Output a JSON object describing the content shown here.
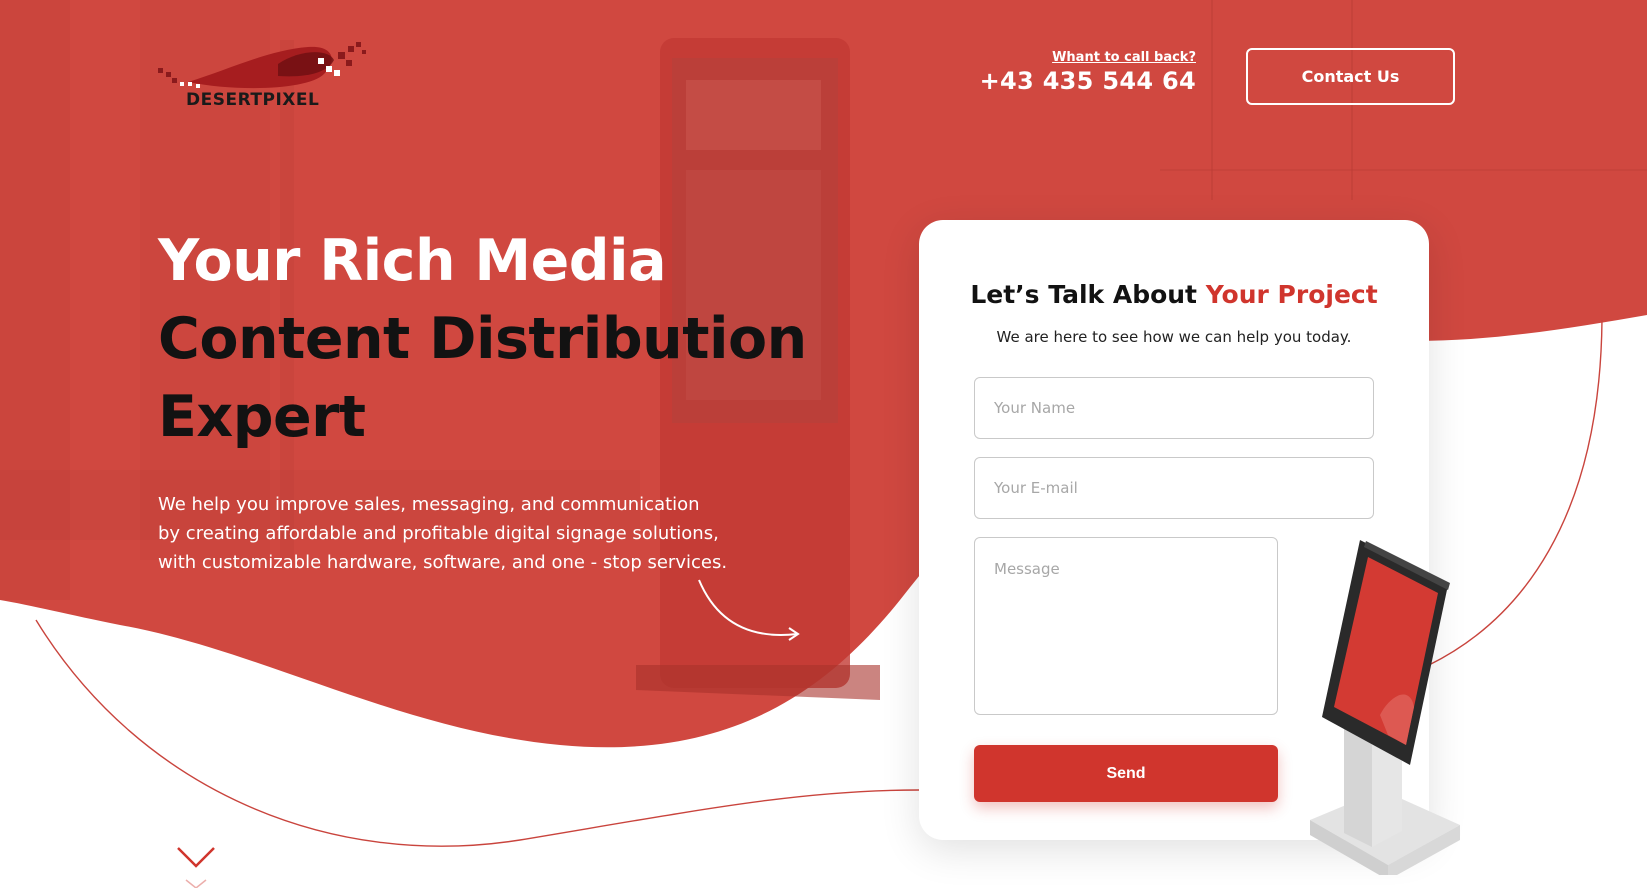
{
  "brand": {
    "name": "DESERTPIXEL",
    "accent_color": "#d0352d",
    "hero_bg_color": "#d04840"
  },
  "header": {
    "callback_link": "Whant to call back?",
    "phone": "+43 435 544 64",
    "contact_button": "Contact Us"
  },
  "hero": {
    "title_line1": "Your Rich Media",
    "title_line2": "Content Distribution",
    "title_line3": "Expert",
    "subtitle_line1": "We help you improve sales, messaging, and communication",
    "subtitle_line2": "by creating affordable and profitable digital signage solutions,",
    "subtitle_line3": "with customizable hardware, software, and one - stop services."
  },
  "form": {
    "title_prefix": "Let’s Talk About",
    "title_accent": "Your Project",
    "subtitle": "We are here to see how we can help you today.",
    "name_placeholder": "Your Name",
    "email_placeholder": "Your E-mail",
    "message_placeholder": "Message",
    "send_label": "Send"
  },
  "icons": {
    "scroll": "chevron-down-icon",
    "arrow": "curved-arrow-icon",
    "kiosk": "kiosk-illustration"
  }
}
